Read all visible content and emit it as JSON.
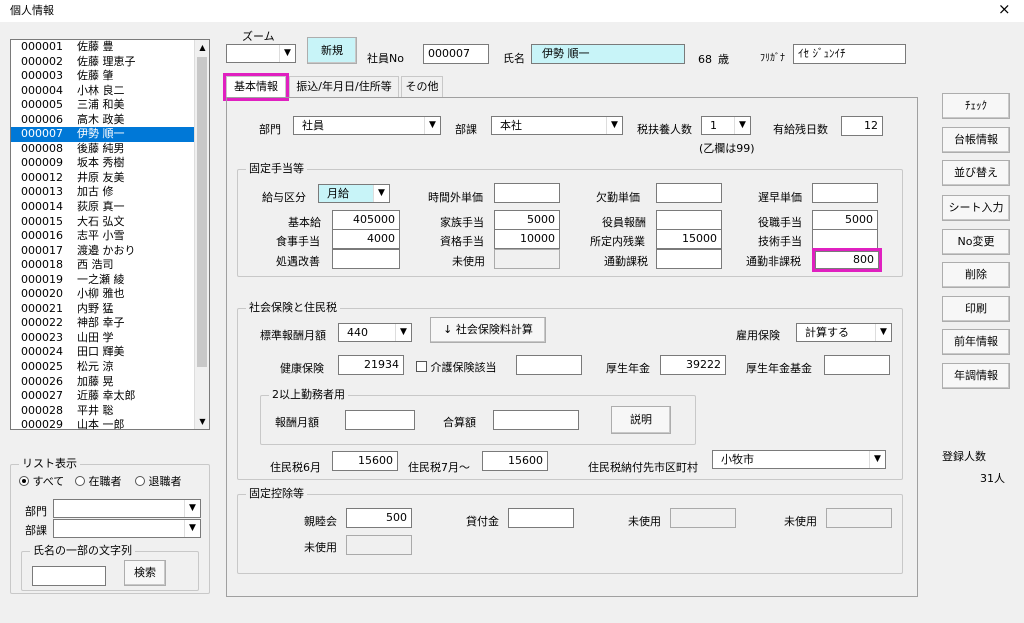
{
  "window": {
    "title": "個人情報",
    "close_glyph": "×"
  },
  "zoom": {
    "label": "ズーム",
    "value": ""
  },
  "new_button": "新規",
  "employee_no": {
    "label": "社員No",
    "value": "000007"
  },
  "name": {
    "label": "氏名",
    "value": "伊勢 順一"
  },
  "age": {
    "value": "68",
    "unit": "歳"
  },
  "furigana": {
    "label": "ﾌﾘｶﾞﾅ",
    "value": "ｲｾ ｼﾞｭﾝｲﾁ"
  },
  "employee_list": [
    {
      "no": "000001",
      "name": "佐藤 豊"
    },
    {
      "no": "000002",
      "name": "佐藤 理恵子"
    },
    {
      "no": "000003",
      "name": "佐藤 肇"
    },
    {
      "no": "000004",
      "name": "小林 良二"
    },
    {
      "no": "000005",
      "name": "三浦 和美"
    },
    {
      "no": "000006",
      "name": "高木 政美"
    },
    {
      "no": "000007",
      "name": "伊勢 順一"
    },
    {
      "no": "000008",
      "name": "後藤 純男"
    },
    {
      "no": "000009",
      "name": "坂本 秀樹"
    },
    {
      "no": "000012",
      "name": "井原 友美"
    },
    {
      "no": "000013",
      "name": "加古 修"
    },
    {
      "no": "000014",
      "name": "荻原 真一"
    },
    {
      "no": "000015",
      "name": "大石 弘文"
    },
    {
      "no": "000016",
      "name": "志平 小雪"
    },
    {
      "no": "000017",
      "name": "渡邉 かおり"
    },
    {
      "no": "000018",
      "name": "西 浩司"
    },
    {
      "no": "000019",
      "name": "一之瀬 綾"
    },
    {
      "no": "000020",
      "name": "小柳 雅也"
    },
    {
      "no": "000021",
      "name": "内野 猛"
    },
    {
      "no": "000022",
      "name": "神部 幸子"
    },
    {
      "no": "000023",
      "name": "山田 学"
    },
    {
      "no": "000024",
      "name": "田口 輝美"
    },
    {
      "no": "000025",
      "name": "松元 涼"
    },
    {
      "no": "000026",
      "name": "加藤 晃"
    },
    {
      "no": "000027",
      "name": "近藤 幸太郎"
    },
    {
      "no": "000028",
      "name": "平井 聡"
    },
    {
      "no": "000029",
      "name": "山本 一郎"
    }
  ],
  "selected_index": 6,
  "list_filter": {
    "title": "リスト表示",
    "radio_all": "すべて",
    "radio_active": "在職者",
    "radio_retired": "退職者",
    "dept_label": "部門",
    "section_label": "部課",
    "name_part_title": "氏名の一部の文字列",
    "search_button": "検索"
  },
  "tabs": [
    "基本情報",
    "振込/年月日/住所等",
    "その他"
  ],
  "basic": {
    "dept_label": "部門",
    "dept_value": "社員",
    "section_label": "部課",
    "section_value": "本社",
    "dependents_label": "税扶養人数",
    "dependents_value": "1",
    "dependents_note": "(乙欄は99)",
    "paid_leave_label": "有給残日数",
    "paid_leave_value": "12"
  },
  "fixed_allowance": {
    "title": "固定手当等",
    "pay_type_label": "給与区分",
    "pay_type_value": "月給",
    "overtime_label": "時間外単価",
    "overtime_value": "",
    "absence_label": "欠勤単価",
    "absence_value": "",
    "late_label": "遅早単価",
    "late_value": "",
    "base_label": "基本給",
    "base_value": "405000",
    "family_label": "家族手当",
    "family_value": "5000",
    "officer_label": "役員報酬",
    "officer_value": "",
    "position_label": "役職手当",
    "position_value": "5000",
    "meal_label": "食事手当",
    "meal_value": "4000",
    "qual_label": "資格手当",
    "qual_value": "10000",
    "scheduled_ot_label": "所定内残業",
    "scheduled_ot_value": "15000",
    "skill_label": "技術手当",
    "skill_value": "",
    "treatment_label": "処遇改善",
    "treatment_value": "",
    "unused_label": "未使用",
    "unused_value": "",
    "commute_tax_label": "通勤課税",
    "commute_tax_value": "",
    "commute_nontax_label": "通勤非課税",
    "commute_nontax_value": "800"
  },
  "social": {
    "title": "社会保険と住民税",
    "std_monthly_label": "標準報酬月額",
    "std_monthly_value": "440",
    "calc_button": "↓ 社会保険料計算",
    "employment_label": "雇用保険",
    "employment_value": "計算する",
    "health_label": "健康保険",
    "health_value": "21934",
    "care_label": "介護保険該当",
    "care_value": "",
    "pension_label": "厚生年金",
    "pension_value": "39222",
    "pension_fund_label": "厚生年金基金",
    "pension_fund_value": "",
    "multi_title": "2以上勤務者用",
    "multi_pay_label": "報酬月額",
    "multi_pay_value": "",
    "multi_total_label": "合算額",
    "multi_total_value": "",
    "explain_button": "説明",
    "res_tax_jun_label": "住民税6月",
    "res_tax_jun_value": "15600",
    "res_tax_jul_label": "住民税7月～",
    "res_tax_jul_value": "15600",
    "res_city_label": "住民税納付先市区町村",
    "res_city_value": "小牧市"
  },
  "fixed_deduction": {
    "title": "固定控除等",
    "social_club_label": "親睦会",
    "social_club_value": "500",
    "loan_label": "貸付金",
    "loan_value": "",
    "unused1_label": "未使用",
    "unused2_label": "未使用",
    "unused3_label": "未使用"
  },
  "side_buttons": [
    "ﾁｪｯｸ",
    "台帳情報",
    "並び替え",
    "シート入力",
    "No変更",
    "削除",
    "印刷",
    "前年情報",
    "年調情報"
  ],
  "registered": {
    "label": "登録人数",
    "value": "31人"
  },
  "highlight_color": "#e020c0"
}
